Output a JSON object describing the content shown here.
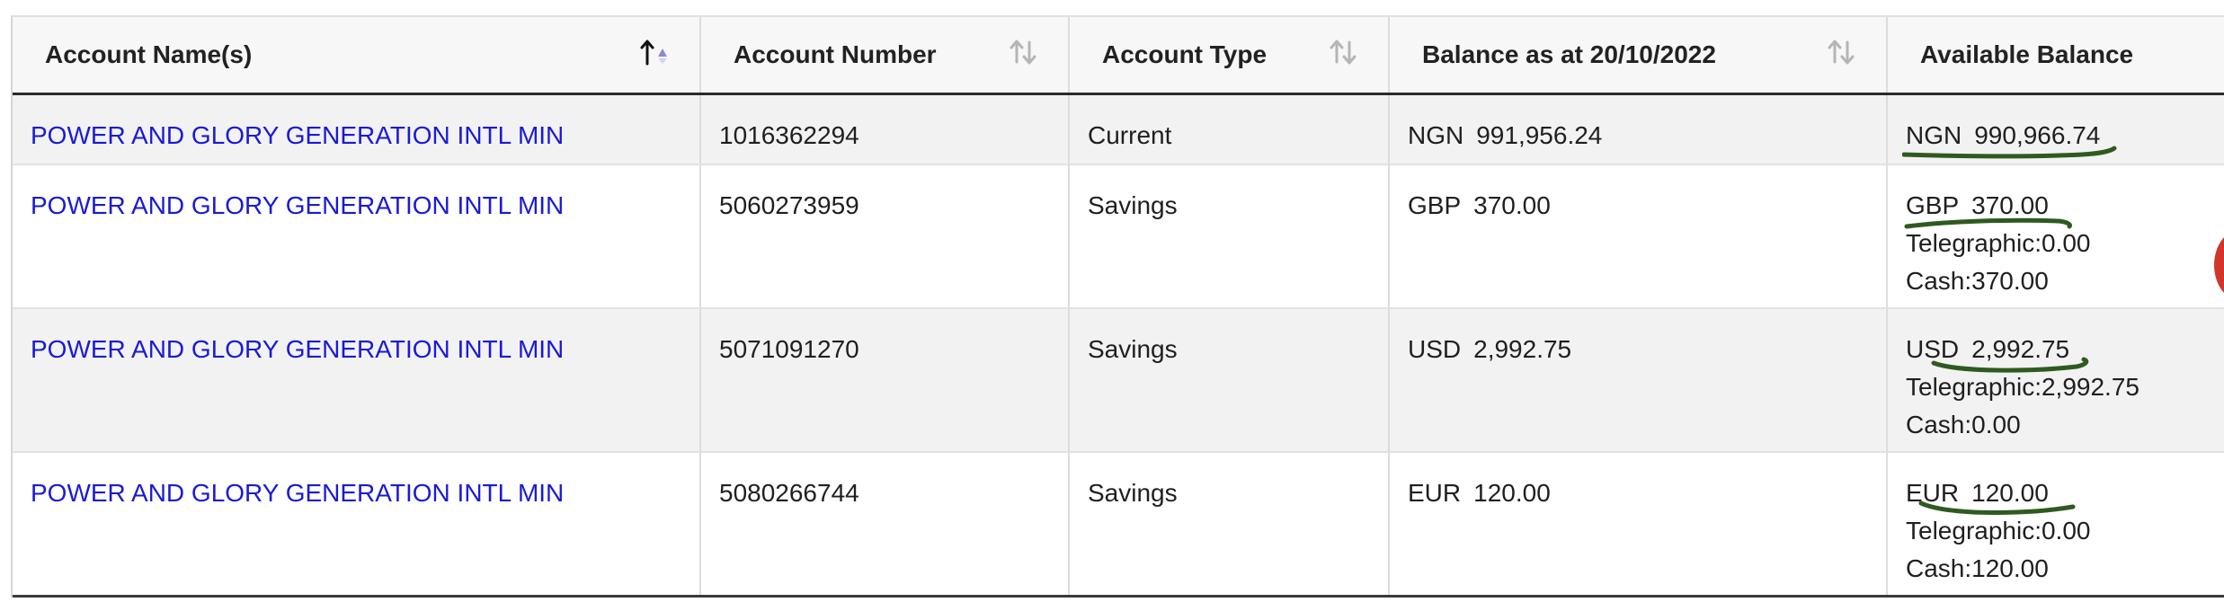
{
  "table": {
    "headers": {
      "name": "Account Name(s)",
      "number": "Account Number",
      "type": "Account Type",
      "balance": "Balance as at 20/10/2022",
      "available": "Available Balance"
    },
    "rows": [
      {
        "name": "POWER AND GLORY GENERATION INTL MIN",
        "number": "1016362294",
        "type": "Current",
        "balance_ccy": "NGN",
        "balance": "991,956.24",
        "avail_ccy": "NGN",
        "avail": "990,966.74"
      },
      {
        "name": "POWER AND GLORY GENERATION INTL MIN",
        "number": "5060273959",
        "type": "Savings",
        "balance_ccy": "GBP",
        "balance": "370.00",
        "avail_ccy": "GBP",
        "avail": "370.00",
        "telegraphic": "Telegraphic:0.00",
        "cash": "Cash:370.00"
      },
      {
        "name": "POWER AND GLORY GENERATION INTL MIN",
        "number": "5071091270",
        "type": "Savings",
        "balance_ccy": "USD",
        "balance": "2,992.75",
        "avail_ccy": "USD",
        "avail": "2,992.75",
        "telegraphic": "Telegraphic:2,992.75",
        "cash": "Cash:0.00"
      },
      {
        "name": "POWER AND GLORY GENERATION INTL MIN",
        "number": "5080266744",
        "type": "Savings",
        "balance_ccy": "EUR",
        "balance": "120.00",
        "avail_ccy": "EUR",
        "avail": "120.00",
        "telegraphic": "Telegraphic:0.00",
        "cash": "Cash:120.00"
      }
    ]
  },
  "colors": {
    "link": "#1a1ad6",
    "header_bg": "#f7f7f7",
    "row_shade": "#f2f2f2",
    "annotation": "#2f5a1f",
    "overlay_blob": "#d2352c"
  },
  "icons": {
    "sort_active": "sort-ascending-icon",
    "sort_inactive": "sort-both-icon"
  }
}
